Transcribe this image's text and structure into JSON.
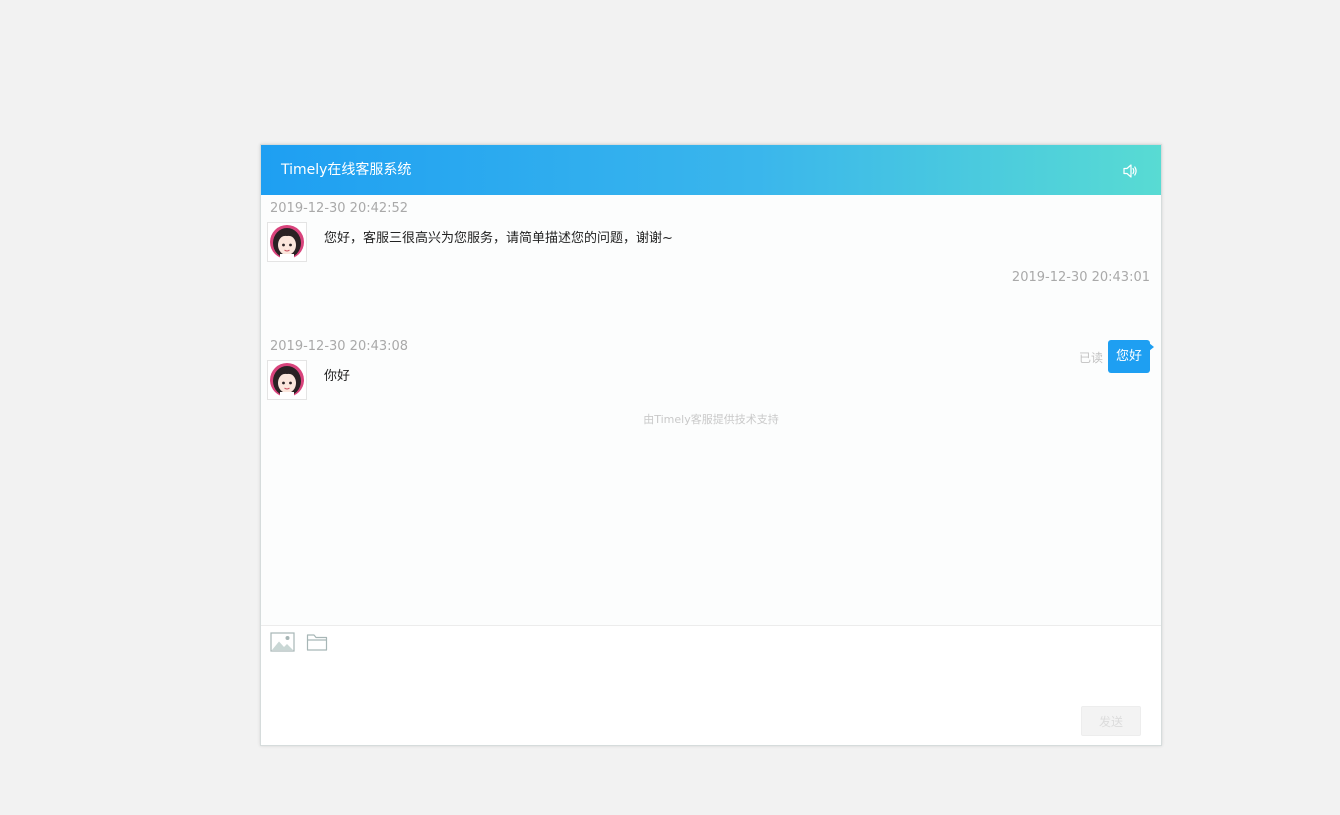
{
  "header": {
    "title": "Timely在线客服系统",
    "sound_icon": "speaker-icon"
  },
  "messages": [
    {
      "side": "left",
      "timestamp": "2019-12-30 20:42:52",
      "text": "您好，客服三很高兴为您服务，请简单描述您的问题，谢谢~",
      "avatar": "agent-avatar"
    },
    {
      "side": "right",
      "timestamp": "2019-12-30 20:43:01",
      "text": "您好",
      "status": "已读"
    },
    {
      "side": "left",
      "timestamp": "2019-12-30 20:43:08",
      "text": "你好",
      "avatar": "agent-avatar"
    }
  ],
  "footer_note": "由Timely客服提供技术支持",
  "toolbar": {
    "image_icon": "image-icon",
    "folder_icon": "folder-icon"
  },
  "input": {
    "value": "",
    "placeholder": ""
  },
  "send_label": "发送",
  "colors": {
    "accent": "#1e9ff2",
    "header_end": "#58dbd3",
    "timestamp": "#a9a9a9"
  }
}
